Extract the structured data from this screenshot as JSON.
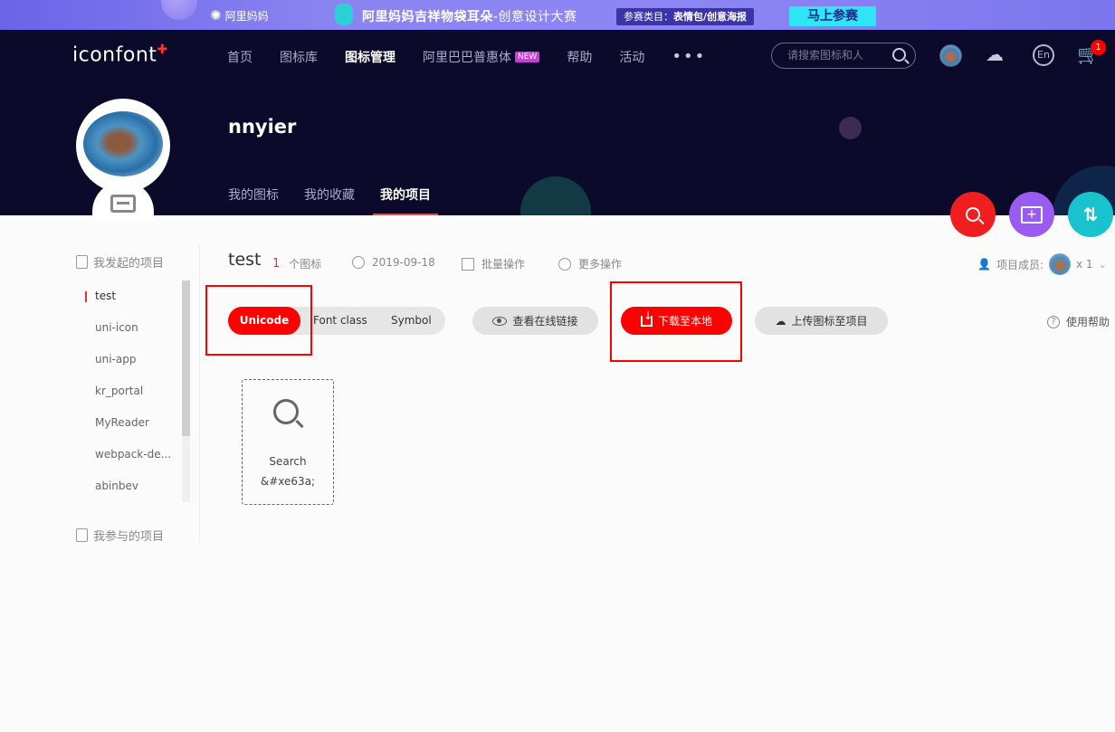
{
  "banner": {
    "alimama": "阿里妈妈",
    "title_main": "阿里妈妈吉祥物袋耳朵",
    "title_sub": "-创意设计大赛",
    "category_label": "参赛类目：",
    "category_value": "表情包/创意海报",
    "join_button": "马上参赛"
  },
  "header": {
    "logo": "iconfont",
    "nav": [
      "首页",
      "图标库",
      "图标管理",
      "阿里巴巴普惠体",
      "帮助",
      "活动"
    ],
    "nav_new_badge": "NEW",
    "search_placeholder": "请搜索图标和人",
    "en_label": "En",
    "cart_count": "1"
  },
  "profile": {
    "username": "nnyier",
    "tabs": [
      "我的图标",
      "我的收藏",
      "我的项目"
    ]
  },
  "sidebar": {
    "my_projects_heading": "我发起的项目",
    "participated_heading": "我参与的项目",
    "projects": [
      "test",
      "uni-icon",
      "uni-app",
      "kr_portal",
      "MyReader",
      "webpack-de...",
      "abinbev"
    ]
  },
  "project": {
    "title": "test",
    "icon_count": "1",
    "icon_count_label": "个图标",
    "date": "2019-09-18",
    "batch_ops": "批量操作",
    "more_ops": "更多操作",
    "members_label": "项目成员:",
    "members_count": "x 1"
  },
  "toolbar": {
    "formats": [
      "Unicode",
      "Font class",
      "Symbol"
    ],
    "view_link": "查看在线链接",
    "download": "下载至本地",
    "upload": "上传图标至项目",
    "help": "使用帮助"
  },
  "icons": [
    {
      "name": "Search",
      "code": "&#xe63a;"
    }
  ]
}
